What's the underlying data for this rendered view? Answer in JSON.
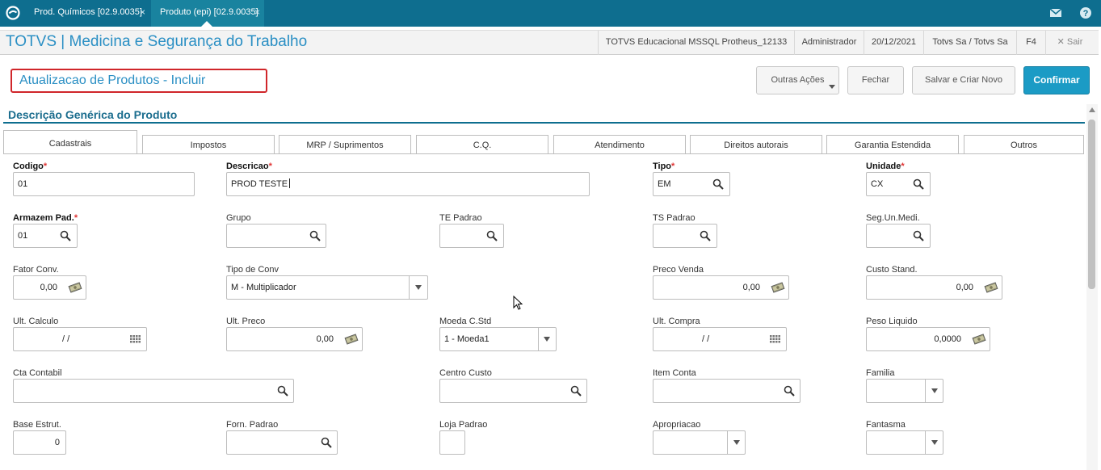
{
  "tabs": [
    {
      "label": "Prod. Químicos [02.9.0035]",
      "close": "×"
    },
    {
      "label": "Produto (epi) [02.9.0035]",
      "close": "×"
    }
  ],
  "header": {
    "title": "TOTVS | Medicina e Segurança do Trabalho",
    "environment": "TOTVS Educacional MSSQL Protheus_12133",
    "user": "Administrador",
    "date": "20/12/2021",
    "company": "Totvs Sa / Totvs Sa",
    "shortcut": "F4",
    "exit": "✕ Sair"
  },
  "page": {
    "title": "Atualizacao de Produtos - Incluir"
  },
  "actions": {
    "more": "Outras Ações",
    "close": "Fechar",
    "save_new": "Salvar e Criar Novo",
    "confirm": "Confirmar"
  },
  "section": {
    "title": "Descrição Genérica do Produto"
  },
  "form_tabs": [
    "Cadastrais",
    "Impostos",
    "MRP / Suprimentos",
    "C.Q.",
    "Atendimento",
    "Direitos autorais",
    "Garantia Estendida",
    "Outros"
  ],
  "fields": {
    "codigo": {
      "label": "Codigo",
      "value": "01"
    },
    "descricao": {
      "label": "Descricao",
      "value": "PROD TESTE"
    },
    "tipo": {
      "label": "Tipo",
      "value": "EM"
    },
    "unidade": {
      "label": "Unidade",
      "value": "CX"
    },
    "armazem": {
      "label": "Armazem Pad.",
      "value": "01"
    },
    "grupo": {
      "label": "Grupo",
      "value": ""
    },
    "te_padrao": {
      "label": "TE Padrao",
      "value": ""
    },
    "ts_padrao": {
      "label": "TS Padrao",
      "value": ""
    },
    "seg_un": {
      "label": "Seg.Un.Medi.",
      "value": ""
    },
    "fator_conv": {
      "label": "Fator Conv.",
      "value": "0,00"
    },
    "tipo_conv": {
      "label": "Tipo de Conv",
      "value": "M - Multiplicador"
    },
    "preco_venda": {
      "label": "Preco Venda",
      "value": "0,00"
    },
    "custo_stand": {
      "label": "Custo Stand.",
      "value": "0,00"
    },
    "ult_calculo": {
      "label": "Ult. Calculo",
      "value": "/ /"
    },
    "ult_preco": {
      "label": "Ult. Preco",
      "value": "0,00"
    },
    "moeda_cstd": {
      "label": "Moeda C.Std",
      "value": "1 - Moeda1"
    },
    "ult_compra": {
      "label": "Ult. Compra",
      "value": "/ /"
    },
    "peso_liquido": {
      "label": "Peso Liquido",
      "value": "0,0000"
    },
    "cta_contabil": {
      "label": "Cta Contabil",
      "value": ""
    },
    "centro_custo": {
      "label": "Centro Custo",
      "value": ""
    },
    "item_conta": {
      "label": "Item Conta",
      "value": ""
    },
    "familia": {
      "label": "Familia",
      "value": ""
    },
    "base_estrut": {
      "label": "Base Estrut.",
      "value": "0"
    },
    "forn_padrao": {
      "label": "Forn. Padrao",
      "value": ""
    },
    "loja_padrao": {
      "label": "Loja Padrao",
      "value": ""
    },
    "apropriacao": {
      "label": "Apropriacao",
      "value": ""
    },
    "fantasma": {
      "label": "Fantasma",
      "value": ""
    }
  },
  "required_marker": "*",
  "colors": {
    "topbar": "#0e6e8f",
    "accent": "#2a8fc4",
    "primary_button": "#1b9bc5",
    "required": "#e03333",
    "highlight_border": "#d0262a"
  },
  "icons": {
    "search": "magnifier-icon",
    "money": "money-icon",
    "calendar": "calendar-icon",
    "logo": "totvs-logo-icon",
    "mail": "mail-icon",
    "help": "help-icon"
  }
}
